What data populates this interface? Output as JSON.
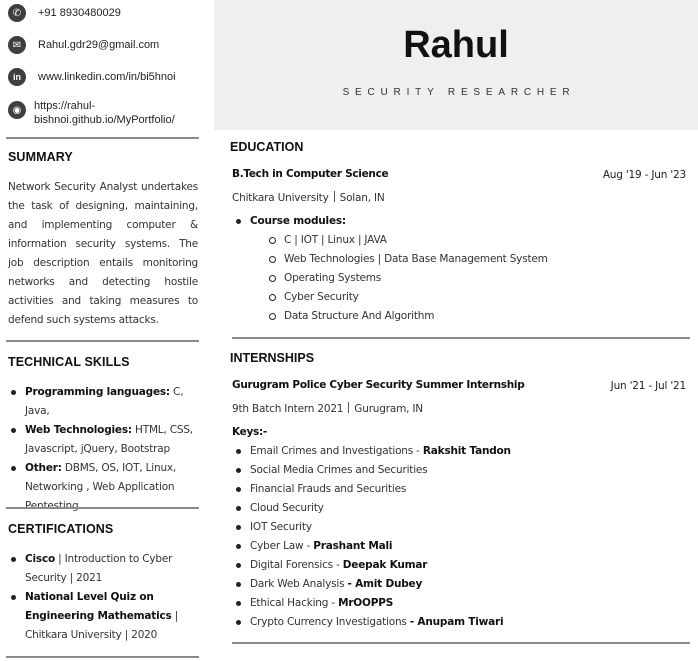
{
  "contact": {
    "phone": "+91 8930480029",
    "email": "Rahul.gdr29@gmail.com",
    "linkedin": "www.linkedin.com/in/bi5hnoi",
    "website_line1": "https://rahul-",
    "website_line2": "bishnoi.github.io/MyPortfolio/",
    "icons": [
      "phone-icon",
      "envelope-icon",
      "linkedin-icon",
      "globe-icon"
    ]
  },
  "summary": {
    "heading": "SUMMARY",
    "text": "Network Security Analyst undertakes the task of designing, maintaining, and implementing computer & information security systems. The job description entails monitoring networks and detecting hostile activities and taking measures to defend such systems attacks."
  },
  "skills": {
    "heading": "TECHNICAL SKILLS",
    "items": [
      {
        "label": "Programming languages:",
        "value": " C, Java,"
      },
      {
        "label": "Web Technologies:",
        "value": " HTML, CSS, Javascript, jQuery, Bootstrap"
      },
      {
        "label": "Other:",
        "value": " DBMS, OS, IOT, Linux, Networking , Web Application Pentesting"
      }
    ]
  },
  "certifications": {
    "heading": "CERTIFICATIONS",
    "items": [
      {
        "label": "Cisco",
        "value": " | Introduction to Cyber Security | 2021"
      },
      {
        "label": "National Level Quiz on Engineering Mathematics",
        "value": " | Chitkara University | 2020"
      }
    ]
  },
  "header": {
    "name": "Rahul",
    "role": "SECURITY RESEARCHER"
  },
  "education": {
    "heading": "EDUCATION",
    "degree": "B.Tech in Computer Science",
    "date_start": "Aug '19",
    "date_end": "Jun '23",
    "institution": "Chitkara University",
    "location": "Solan, IN",
    "modules_label": "Course modules:",
    "modules": [
      "C | IOT | Linux | JAVA",
      "Web Technologies | Data Base Management System",
      "Operating Systems",
      "Cyber Security",
      "Data Structure And Algorithm"
    ]
  },
  "internships": {
    "heading": "INTERNSHIPS",
    "title": "Gurugram Police Cyber Security Summer Internship",
    "date_start": "Jun '21",
    "date_end": "Jul '21",
    "role": "9th Batch Intern 2021",
    "location": "Gurugram, IN",
    "keys_label": "Keys:-",
    "keys": [
      {
        "text": "Email Crimes and Investigations - ",
        "bold": "Rakshit Tandon"
      },
      {
        "text": "Social Media Crimes and Securities",
        "bold": ""
      },
      {
        "text": "Financial Frauds and Securities",
        "bold": ""
      },
      {
        "text": "Cloud Security",
        "bold": ""
      },
      {
        "text": "IOT Security",
        "bold": ""
      },
      {
        "text": "Cyber Law - ",
        "bold": "Prashant Mali"
      },
      {
        "text": "Digital Forensics - ",
        "bold": "Deepak Kumar"
      },
      {
        "text": "Dark Web Analysis ",
        "bold": "- Amit Dubey"
      },
      {
        "text": "Ethical Hacking - ",
        "bold": "MrOOPPS"
      },
      {
        "text": "Crypto Currency Investigations ",
        "bold": "- Anupam Tiwari"
      }
    ]
  }
}
